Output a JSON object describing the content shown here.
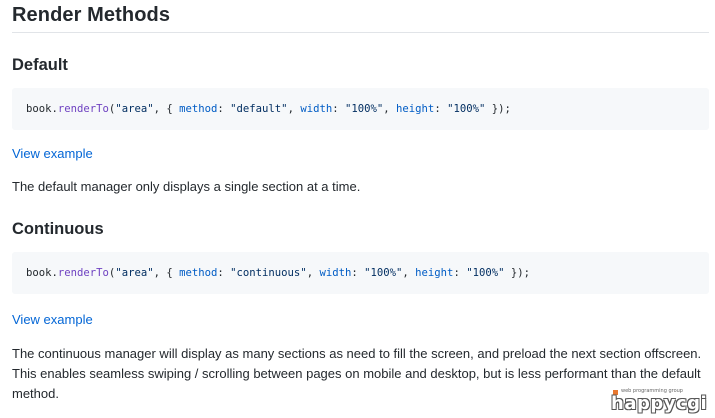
{
  "heading": "Render Methods",
  "sections": [
    {
      "title": "Default",
      "code": {
        "obj": "book.",
        "fn": "renderTo",
        "open": "(",
        "arg1": "\"area\"",
        "comma1": ", { ",
        "k1": "method",
        "colon1": ": ",
        "v1": "\"default\"",
        "comma2": ", ",
        "k2": "width",
        "colon2": ": ",
        "v2": "\"100%\"",
        "comma3": ", ",
        "k3": "height",
        "colon3": ": ",
        "v3": "\"100%\"",
        "close": " });"
      },
      "link": "View example",
      "description": "The default manager only displays a single section at a time."
    },
    {
      "title": "Continuous",
      "code": {
        "obj": "book.",
        "fn": "renderTo",
        "open": "(",
        "arg1": "\"area\"",
        "comma1": ", { ",
        "k1": "method",
        "colon1": ": ",
        "v1": "\"continuous\"",
        "comma2": ", ",
        "k2": "width",
        "colon2": ": ",
        "v2": "\"100%\"",
        "comma3": ", ",
        "k3": "height",
        "colon3": ": ",
        "v3": "\"100%\"",
        "close": " });"
      },
      "link": "View example",
      "description": "The continuous manager will display as many sections as need to fill the screen, and preload the next section offscreen. This enables seamless swiping / scrolling between pages on mobile and desktop, but is less performant than the default method."
    }
  ],
  "watermark": {
    "word": "happycgi",
    "tagline": "web programming group"
  },
  "colors": {
    "link": "#0366d6",
    "code_bg": "#f6f8fa",
    "code_fn": "#6f42c1",
    "code_key": "#005cc5",
    "code_str": "#032f62"
  }
}
